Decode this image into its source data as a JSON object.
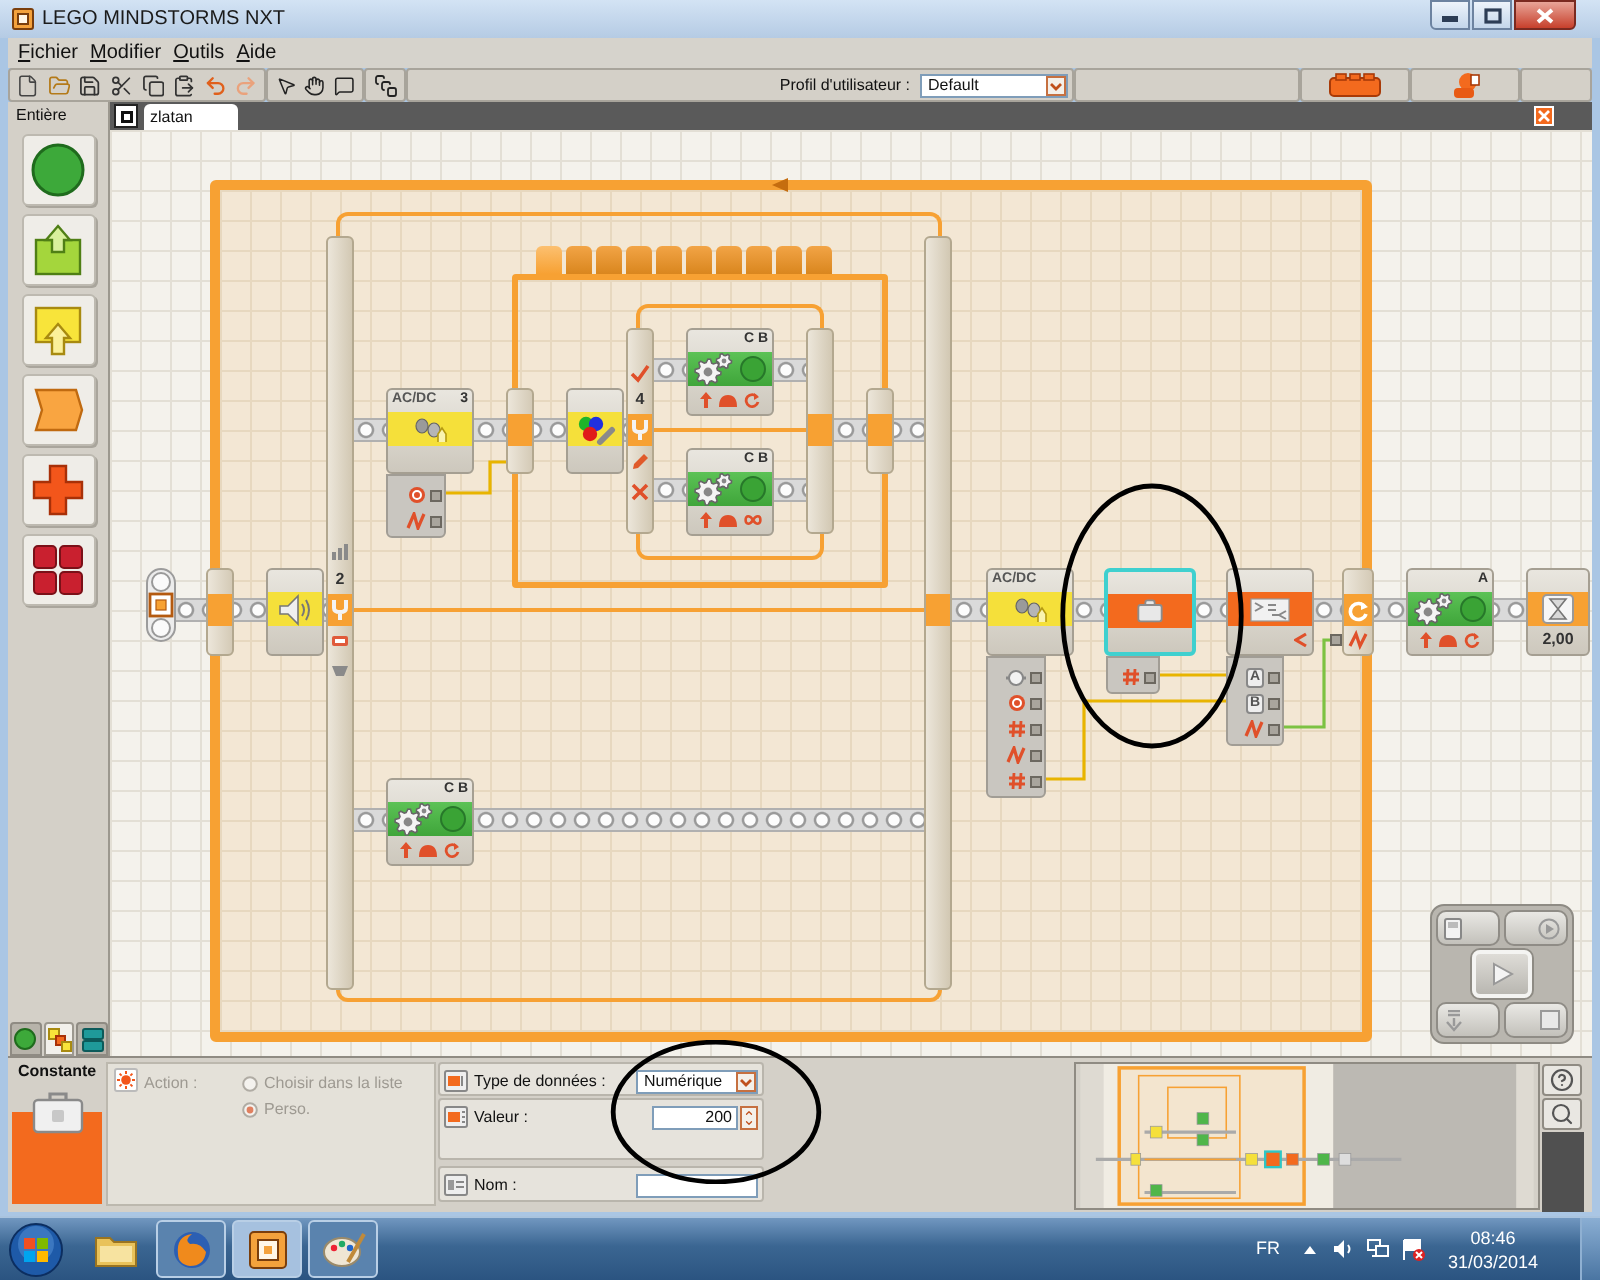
{
  "window": {
    "title": "LEGO MINDSTORMS NXT"
  },
  "menu": [
    "Fichier",
    "Modifier",
    "Outils",
    "Aide"
  ],
  "toolbar": {
    "profile_label": "Profil d'utilisateur :",
    "profile_value": "Default"
  },
  "palette": {
    "title": "Entière",
    "items": [
      {
        "kind": "circle"
      },
      {
        "kind": "green-upload"
      },
      {
        "kind": "yellow-upload"
      },
      {
        "kind": "banner"
      },
      {
        "kind": "cross"
      },
      {
        "kind": "grid"
      }
    ],
    "tabs": [
      {
        "kind": "circle",
        "selected": false
      },
      {
        "kind": "blocks",
        "selected": true
      },
      {
        "kind": "stack",
        "selected": false
      }
    ]
  },
  "program_tabs": [
    {
      "label": "zlatan",
      "selected": true
    }
  ],
  "canvas": {
    "structures": [
      {
        "kind": "loop"
      },
      {
        "kind": "switch"
      },
      {
        "kind": "tabbed-frame",
        "tabs": [
          {
            "selected": true
          },
          {
            "selected": false
          },
          {
            "selected": false
          },
          {
            "selected": false
          },
          {
            "selected": false
          },
          {
            "selected": false
          },
          {
            "selected": false
          },
          {
            "selected": false
          },
          {
            "selected": false
          },
          {
            "selected": false
          }
        ]
      },
      {
        "kind": "switch"
      }
    ],
    "blocks": [
      {
        "kind": "sound-switch",
        "port": "2",
        "selected": false
      },
      {
        "kind": "sound-sensor",
        "icon_text": "AC/DC",
        "port": "3",
        "selected": false,
        "hub_ports": [
          {
            "kind": "target"
          },
          {
            "kind": "signal"
          }
        ]
      },
      {
        "kind": "color-switch",
        "port": "4",
        "selected": false
      },
      {
        "kind": "motor",
        "port": "C B",
        "unlimited": false,
        "selected": false
      },
      {
        "kind": "motor",
        "port": "C B",
        "unlimited": true,
        "selected": false
      },
      {
        "kind": "motor",
        "port": "C B",
        "unlimited": false,
        "selected": false
      },
      {
        "kind": "sound-sensor",
        "icon_text": "AC/DC",
        "selected": false,
        "hub_ports": [
          {
            "kind": "plug"
          },
          {
            "kind": "target"
          },
          {
            "kind": "hash"
          },
          {
            "kind": "signal"
          },
          {
            "kind": "hash"
          }
        ]
      },
      {
        "kind": "constant",
        "selected": true,
        "hub_ports": [
          {
            "kind": "hash"
          }
        ]
      },
      {
        "kind": "compare",
        "selected": false,
        "hub_ports": [
          {
            "kind": "letter",
            "label": "A"
          },
          {
            "kind": "letter",
            "label": "B"
          },
          {
            "kind": "signal"
          }
        ]
      },
      {
        "kind": "motor",
        "port": "A",
        "unlimited": false,
        "selected": false
      },
      {
        "kind": "wait",
        "value": "2,00",
        "selected": false
      }
    ]
  },
  "config": {
    "title": "Constante",
    "action": {
      "label": "Action :",
      "disabled": true,
      "options": [
        {
          "label": "Choisir dans la liste",
          "selected": false
        },
        {
          "label": "Perso.",
          "selected": true
        }
      ]
    },
    "fields": [
      {
        "kind": "select",
        "label": "Type de données :",
        "value": "Numérique"
      },
      {
        "kind": "number",
        "label": "Valeur :",
        "value": "200"
      },
      {
        "kind": "text",
        "label": "Nom :"
      }
    ]
  },
  "taskbar": {
    "apps": [
      {
        "kind": "folder",
        "open": false,
        "selected": false
      },
      {
        "kind": "browser",
        "open": true,
        "selected": false
      },
      {
        "kind": "nxt",
        "open": true,
        "selected": true
      },
      {
        "kind": "paint",
        "open": true,
        "selected": false
      }
    ],
    "language": "FR",
    "time": "08:46",
    "date": "31/03/2014"
  },
  "annotations": [
    {
      "kind": "ellipse"
    },
    {
      "kind": "ellipse"
    }
  ]
}
